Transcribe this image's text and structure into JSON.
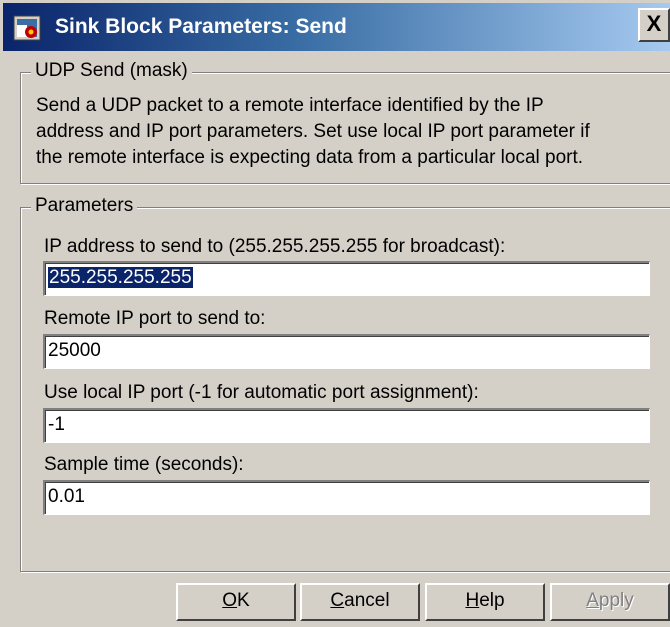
{
  "window": {
    "title": "Sink Block Parameters: Send",
    "close_label": "X"
  },
  "mask": {
    "legend": "UDP Send (mask)",
    "description_lines": [
      "Send a UDP packet to a remote interface identified by the IP",
      "address and IP port parameters. Set use local IP port parameter if",
      "the remote interface is expecting data from a particular local port."
    ]
  },
  "parameters": {
    "legend": "Parameters",
    "fields": [
      {
        "label": "IP address to send to (255.255.255.255 for broadcast):",
        "value": "255.255.255.255",
        "selected": true
      },
      {
        "label": "Remote IP port to send to:",
        "value": "25000"
      },
      {
        "label": "Use local IP port (-1 for automatic port assignment):",
        "value": "-1"
      },
      {
        "label": "Sample time (seconds):",
        "value": "0.01"
      }
    ]
  },
  "buttons": {
    "ok": {
      "label": "OK",
      "mnemonic": "O",
      "rest": "K"
    },
    "cancel": {
      "label": "Cancel",
      "mnemonic": "C",
      "rest": "ancel"
    },
    "help": {
      "label": "Help",
      "mnemonic": "H",
      "rest": "elp"
    },
    "apply": {
      "label": "Apply",
      "mnemonic": "A",
      "rest": "pply",
      "disabled": true
    }
  },
  "colors": {
    "titlebar_start": "#0a246a",
    "titlebar_end": "#a6caf0",
    "dialog_bg": "#d4d0c8",
    "selection": "#0a246a"
  }
}
